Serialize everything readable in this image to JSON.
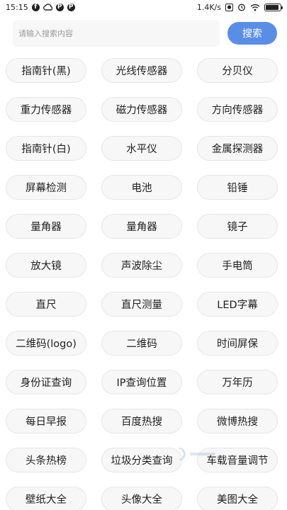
{
  "status_bar": {
    "time": "15:15",
    "icons": [
      "facebook-icon",
      "cloud-icon",
      "p-icon",
      "p-icon"
    ],
    "net_speed": "1.4K/s",
    "right_icons": [
      "screen-record-icon",
      "alarm-icon",
      "wifi-icon",
      "battery-icon"
    ]
  },
  "search": {
    "placeholder": "请输入搜索内容",
    "button_label": "搜索",
    "button_color": "#5a8ee6"
  },
  "tools": [
    {
      "label": "指南针(黑)"
    },
    {
      "label": "光线传感器"
    },
    {
      "label": "分贝仪"
    },
    {
      "label": "重力传感器"
    },
    {
      "label": "磁力传感器"
    },
    {
      "label": "方向传感器"
    },
    {
      "label": "指南针(白)"
    },
    {
      "label": "水平仪"
    },
    {
      "label": "金属探测器"
    },
    {
      "label": "屏幕检测"
    },
    {
      "label": "电池"
    },
    {
      "label": "铅锤"
    },
    {
      "label": "量角器"
    },
    {
      "label": "量角器"
    },
    {
      "label": "镜子"
    },
    {
      "label": "放大镜"
    },
    {
      "label": "声波除尘"
    },
    {
      "label": "手电筒"
    },
    {
      "label": "直尺"
    },
    {
      "label": "直尺测量"
    },
    {
      "label": "LED字幕"
    },
    {
      "label": "二维码(logo)"
    },
    {
      "label": "二维码"
    },
    {
      "label": "时间屏保"
    },
    {
      "label": "身份证查询"
    },
    {
      "label": "IP查询位置"
    },
    {
      "label": "万年历"
    },
    {
      "label": "每日早报"
    },
    {
      "label": "百度热搜"
    },
    {
      "label": "微博热搜"
    },
    {
      "label": "头条热榜"
    },
    {
      "label": "垃圾分类查询"
    },
    {
      "label": "车载音量调节"
    },
    {
      "label": "壁纸大全"
    },
    {
      "label": "头像大全"
    },
    {
      "label": "美图大全"
    }
  ]
}
